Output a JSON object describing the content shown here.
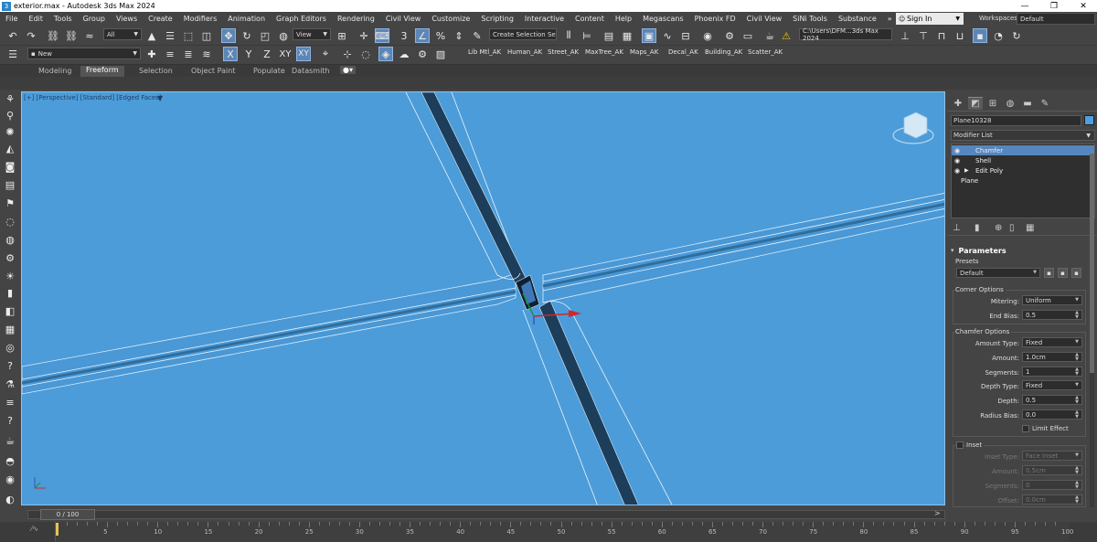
{
  "window": {
    "title": "exterior.max - Autodesk 3ds Max 2024",
    "controls": [
      "—",
      "❐",
      "✕"
    ]
  },
  "menubar": {
    "items": [
      "File",
      "Edit",
      "Tools",
      "Group",
      "Views",
      "Create",
      "Modifiers",
      "Animation",
      "Graph Editors",
      "Rendering",
      "Civil View",
      "Customize",
      "Scripting",
      "Interactive",
      "Content",
      "Help",
      "Megascans",
      "Phoenix FD",
      "Civil View",
      "SiNi Tools",
      "Substance",
      "»"
    ],
    "signin": "Sign In",
    "workspaces_label": "Workspaces:",
    "workspaces_value": "Default"
  },
  "toolbar": {
    "selection_filter": "All",
    "ref_coord": "View",
    "named_selection": "Create Selection Se",
    "project_path": "C:\\Users\\DFM...3ds Max 2024",
    "layer": "New",
    "axis_x": "X",
    "axis_y": "Y",
    "axis_z": "Z",
    "axis_xy": "XY",
    "axis_xy2": "XY"
  },
  "shelf": {
    "tabs": [
      "Lib Mtl_AK",
      "Human_AK",
      "Street_AK",
      "MaxTree_AK",
      "Maps_AK",
      "Decal_AK",
      "Building_AK",
      "Scatter_AK"
    ]
  },
  "ribbon": {
    "tabs": [
      "Modeling",
      "Freeform",
      "Selection",
      "Object Paint",
      "Populate",
      "Datasmith"
    ],
    "active": "Freeform"
  },
  "viewport": {
    "label": "[+] [Perspective] [Standard] [Edged Faces]"
  },
  "command_panel": {
    "object_name": "Plane10328",
    "object_color": "#4f9ee0",
    "modifier_list": "Modifier List",
    "stack": [
      {
        "label": "Chamfer",
        "selected": true
      },
      {
        "label": "Shell",
        "selected": false
      },
      {
        "label": "Edit Poly",
        "selected": false
      },
      {
        "label": "Plane",
        "selected": false
      }
    ],
    "parameters": {
      "title": "Parameters",
      "presets_label": "Presets",
      "presets_value": "Default",
      "corner_options_label": "Corner Options",
      "mitering_label": "Mitering:",
      "mitering_value": "Uniform",
      "end_bias_label": "End Bias:",
      "end_bias_value": "0.5",
      "chamfer_options_label": "Chamfer Options",
      "amount_type_label": "Amount Type:",
      "amount_type_value": "Fixed",
      "amount_label": "Amount:",
      "amount_value": "1.0cm",
      "segments_label": "Segments:",
      "segments_value": "1",
      "depth_type_label": "Depth Type:",
      "depth_type_value": "Fixed",
      "depth_label": "Depth:",
      "depth_value": "0.5",
      "radius_bias_label": "Radius Bias:",
      "radius_bias_value": "0.0",
      "limit_effect_label": "Limit Effect",
      "inset_label": "Inset",
      "inset_type_label": "Inset Type:",
      "inset_type_value": "Face Inset",
      "inset_amount_label": "Amount:",
      "inset_amount_value": "0.5cm",
      "inset_segments_label": "Segments:",
      "inset_segments_value": "0",
      "offset_label": "Offset:",
      "offset_value": "0.0cm"
    }
  },
  "timeline": {
    "frame": "0 / 100",
    "ticks": [
      "5",
      "10",
      "15",
      "20",
      "25",
      "30",
      "35",
      "40",
      "45",
      "50",
      "55",
      "60",
      "65",
      "70",
      "75",
      "80",
      "85",
      "90",
      "95",
      "100"
    ]
  },
  "colors": {
    "viewport_bg": "#4c9cd9",
    "selection_blue": "#5686be",
    "ui_dark": "#444444"
  }
}
